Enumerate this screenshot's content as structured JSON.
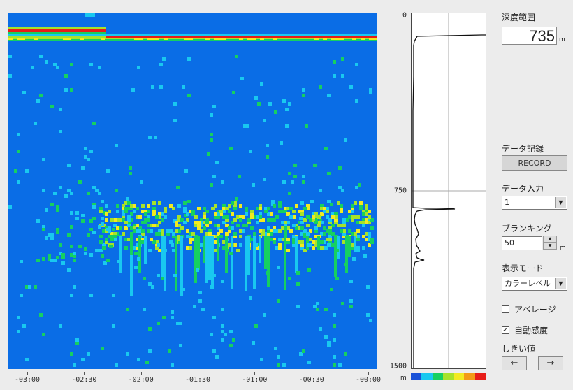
{
  "range": {
    "label": "深度範囲",
    "value": "735",
    "unit": "m"
  },
  "record": {
    "label": "データ記録",
    "button_label": "RECORD"
  },
  "data_input": {
    "label": "データ入力",
    "selected": "1"
  },
  "blanking": {
    "label": "ブランキング",
    "value": "50",
    "unit": "m"
  },
  "display_mode": {
    "label": "表示モード",
    "selected": "カラーレベル"
  },
  "average": {
    "label": "アベレージ",
    "checked": false
  },
  "auto_gain": {
    "label": "自動感度",
    "checked": true
  },
  "threshold": {
    "label": "しきい値",
    "left_label": "←",
    "right_label": "→"
  },
  "depth_axis": {
    "labels": [
      "0",
      "750",
      "1500"
    ],
    "unit": "m"
  },
  "time_axis": {
    "labels": [
      "-03:00",
      "-02:30",
      "-02:00",
      "-01:30",
      "-01:00",
      "-00:30",
      "-00:00"
    ]
  },
  "colors": {
    "background": "#0a6de6",
    "scale": [
      "#1a52d8",
      "#19c8f0",
      "#16d060",
      "#a6e22a",
      "#f2ea21",
      "#f39a16",
      "#e71c18"
    ]
  }
}
